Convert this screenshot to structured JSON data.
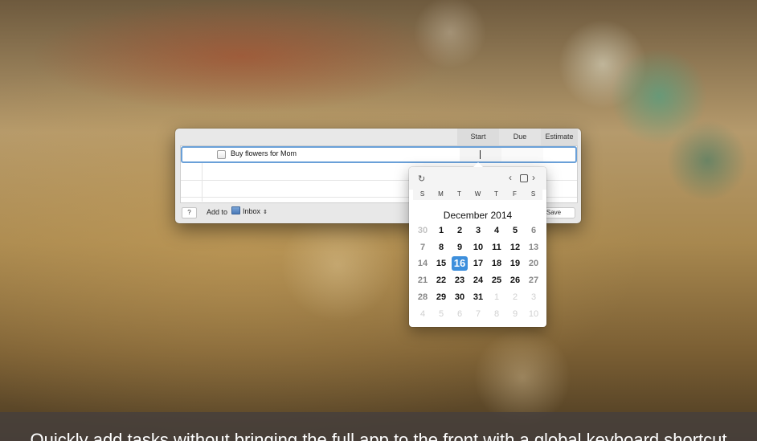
{
  "caption": "Quickly add tasks without bringing the full app to the front with a global keyboard shortcut",
  "quick_entry": {
    "columns": {
      "start": "Start",
      "due": "Due",
      "estimate": "Estimate"
    },
    "task": {
      "title": "Buy flowers for Mom",
      "completed": false
    },
    "help_label": "?",
    "add_to_label": "Add to",
    "project": "Inbox",
    "save_label": "Save"
  },
  "calendar": {
    "month_title": "December 2014",
    "weekdays": [
      "S",
      "M",
      "T",
      "W",
      "T",
      "F",
      "S"
    ],
    "selected_day": "16",
    "weeks": [
      [
        "30",
        "1",
        "2",
        "3",
        "4",
        "5",
        "6"
      ],
      [
        "7",
        "8",
        "9",
        "10",
        "11",
        "12",
        "13"
      ],
      [
        "14",
        "15",
        "16",
        "17",
        "18",
        "19",
        "20"
      ],
      [
        "21",
        "22",
        "23",
        "24",
        "25",
        "26",
        "27"
      ],
      [
        "28",
        "29",
        "30",
        "31",
        "1",
        "2",
        "3"
      ],
      [
        "4",
        "5",
        "6",
        "7",
        "8",
        "9",
        "10"
      ]
    ]
  },
  "colors": {
    "accent": "#3d8fdc",
    "caption_bar": "#46403c"
  }
}
